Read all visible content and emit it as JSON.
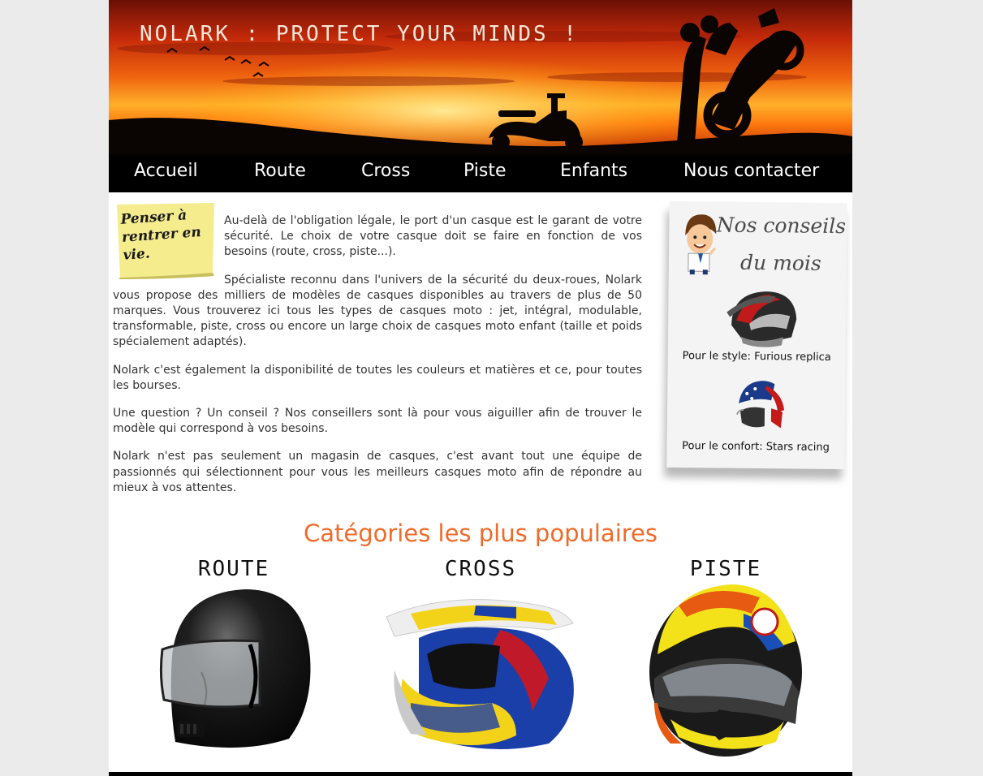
{
  "header": {
    "site_title": "Nolark : Protect your minds !",
    "nav": [
      "Accueil",
      "Route",
      "Cross",
      "Piste",
      "Enfants",
      "Nous contacter"
    ]
  },
  "note": {
    "text": "Penser à rentrer en vie."
  },
  "article": {
    "paragraphs": [
      "Au-delà de l'obligation légale, le port d'un casque est le garant de votre sécurité. Le choix de votre casque doit se faire en fonction de vos besoins (route, cross, piste...).",
      "Spécialiste reconnu dans l'univers de la sécurité du deux-roues, Nolark vous propose des milliers de modèles de casques disponibles au travers de plus de 50 marques. Vous trouverez ici tous les types de casques moto : jet, intégral, modulable, transformable, piste, cross ou encore un large choix de casques moto enfant (taille et poids spécialement adaptés).",
      "Nolark c'est également la disponibilité de toutes les couleurs et matières et ce, pour toutes les bourses.",
      "Une question ? Un conseil ? Nos conseillers sont là pour vous aiguiller afin de trouver le modèle qui correspond à vos besoins.",
      "Nolark n'est pas seulement un magasin de casques, c'est avant tout une équipe de passionnés qui sélectionnent pour vous les meilleurs casques moto afin de répondre au mieux à vos attentes."
    ]
  },
  "advice": {
    "title": "Nos conseils du mois",
    "items": [
      {
        "caption": "Pour le style: Furious replica"
      },
      {
        "caption": "Pour le confort: Stars racing"
      }
    ]
  },
  "categories": {
    "heading": "Catégories les plus populaires",
    "items": [
      {
        "label": "Route"
      },
      {
        "label": "Cross"
      },
      {
        "label": "Piste"
      }
    ]
  },
  "colors": {
    "accent": "#f06a2a",
    "nav_bg": "#000000",
    "page_bg": "#ebebeb"
  }
}
